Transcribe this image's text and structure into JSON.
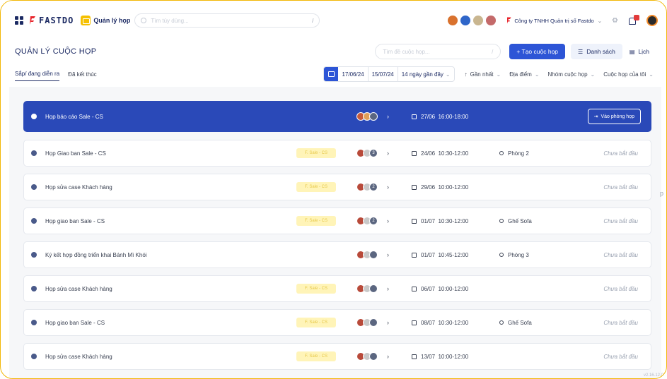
{
  "topbar": {
    "logo_text": "FASTDO",
    "module_label": "Quản lý họp",
    "search_placeholder": "Tìm tùy dùng...",
    "search_shortcut": "/",
    "company": "Công ty TNHH Quản trị số Fastdo",
    "company_chevron": "⌄",
    "settings_glyph": "⚙"
  },
  "title_row": {
    "page_title": "QUẢN LÝ CUỘC HỌP",
    "meeting_search_placeholder": "Tìm đề cuộc họp...",
    "meeting_search_shortcut": "/",
    "create_label": "+ Tạo cuộc họp",
    "list_label": "Danh sách",
    "calendar_label": "Lịch"
  },
  "tabs": [
    {
      "label": "Sắp/ đang diễn ra"
    },
    {
      "label": "Đã kết thúc"
    }
  ],
  "filters": {
    "date_from": "17/06/24",
    "date_to": "15/07/24",
    "range_label": "14 ngày gần đây",
    "sort_label": "Gần nhất",
    "location_label": "Địa điểm",
    "group_label": "Nhóm cuộc họp",
    "mine_label": "Cuộc họp của tôi"
  },
  "selected_row": {
    "title": "Họp báo cáo Sale - CS",
    "date": "27/06",
    "time": "16:00-18:00",
    "room_button": "Vào phòng họp"
  },
  "rows": [
    {
      "title": "Họp Giao ban Sale - CS",
      "tag": "F. Sale - CS",
      "count": "3",
      "date": "24/06",
      "time": "10:30-12:00",
      "room": "Phòng 2",
      "status": "Chưa bắt đầu"
    },
    {
      "title": "Họp sửa case Khách hàng",
      "tag": "F. Sale - CS",
      "count": "2",
      "date": "29/06",
      "time": "10:00-12:00",
      "room": "",
      "status": "Chưa bắt đầu"
    },
    {
      "title": "Họp giao ban Sale - CS",
      "tag": "F. Sale - CS",
      "count": "2",
      "date": "01/07",
      "time": "10:30-12:00",
      "room": "Ghế Sofa",
      "status": "Chưa bắt đầu"
    },
    {
      "title": "Ký kết hợp đồng triển khai Bánh Mì Khói",
      "tag": "",
      "count": "",
      "date": "01/07",
      "time": "10:45-12:00",
      "room": "Phòng 3",
      "status": "Chưa bắt đầu"
    },
    {
      "title": "Họp sửa case Khách hàng",
      "tag": "F. Sale - CS",
      "count": "",
      "date": "06/07",
      "time": "10:00-12:00",
      "room": "",
      "status": "Chưa bắt đầu"
    },
    {
      "title": "Họp giao ban Sale - CS",
      "tag": "F. Sale - CS",
      "count": "",
      "date": "08/07",
      "time": "10:30-12:00",
      "room": "Ghế Sofa",
      "status": "Chưa bắt đầu"
    },
    {
      "title": "Họp sửa case Khách hàng",
      "tag": "F. Sale - CS",
      "count": "",
      "date": "13/07",
      "time": "10:00-12:00",
      "room": "",
      "status": "Chưa bắt đầu"
    }
  ],
  "side_letter": "p",
  "version": "v2.16.12.0",
  "colors": {
    "primary": "#2d55d6",
    "selected_row": "#2a49b8",
    "frame": "#f2b705",
    "tag_bg": "#fff4b8"
  }
}
